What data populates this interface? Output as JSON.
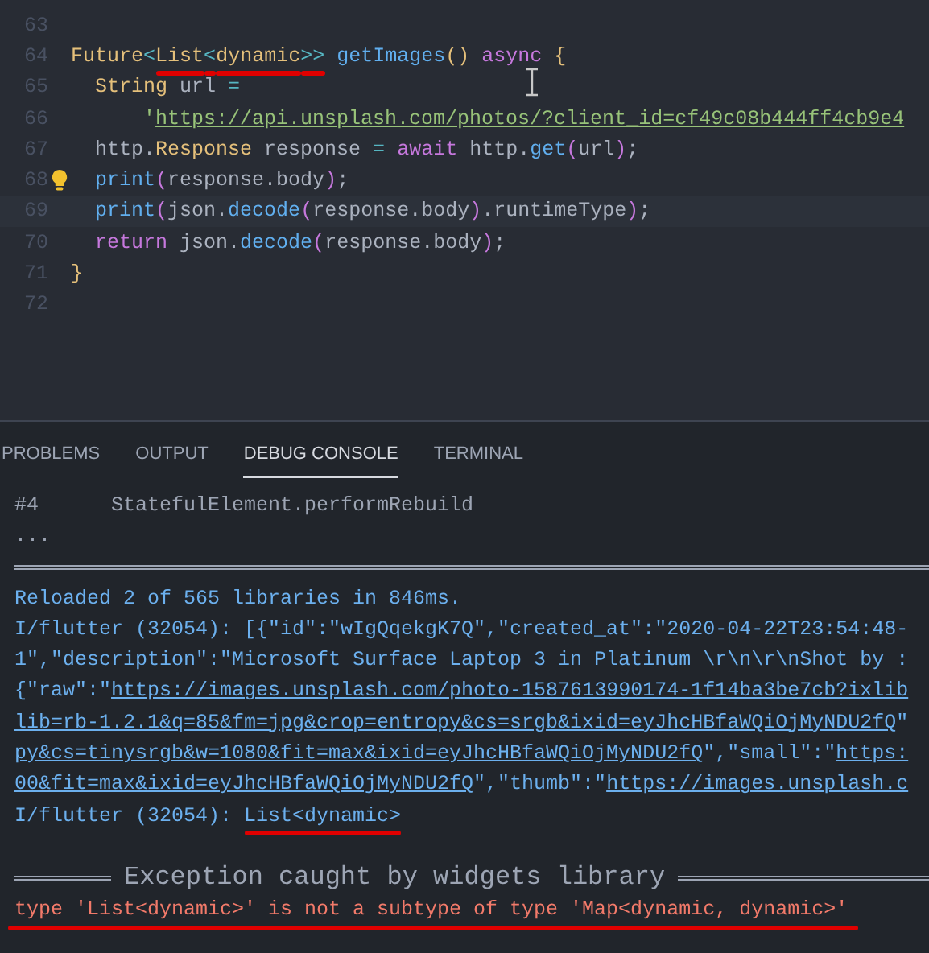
{
  "editor": {
    "lines": [
      {
        "number": "63"
      },
      {
        "number": "64",
        "tokens": [
          {
            "kind": "type",
            "text": "Future"
          },
          {
            "kind": "op",
            "text": "<"
          },
          {
            "kind": "type",
            "text": "List",
            "underlined": true
          },
          {
            "kind": "op",
            "text": "<",
            "underlined": true
          },
          {
            "kind": "type",
            "text": "dynamic",
            "underlined": true
          },
          {
            "kind": "op",
            "text": ">>",
            "underlined": true
          },
          {
            "kind": "fn",
            "text": " getImages"
          },
          {
            "kind": "brace",
            "text": "()"
          },
          {
            "kind": "kw",
            "text": " async"
          },
          {
            "kind": "brace",
            "text": " {"
          }
        ]
      },
      {
        "number": "65",
        "tokens": [
          {
            "kind": "type",
            "text": "  String"
          },
          {
            "kind": "plain",
            "text": " url "
          },
          {
            "kind": "op",
            "text": "="
          }
        ]
      },
      {
        "number": "66",
        "tokens": [
          {
            "kind": "str",
            "text": "      '"
          },
          {
            "kind": "link",
            "text": "https://api.unsplash.com/photos/?client_id=cf49c08b444ff4cb9e4"
          }
        ]
      },
      {
        "number": "67",
        "tokens": [
          {
            "kind": "plain",
            "text": "  http."
          },
          {
            "kind": "type",
            "text": "Response"
          },
          {
            "kind": "plain",
            "text": " response "
          },
          {
            "kind": "op",
            "text": "="
          },
          {
            "kind": "kw",
            "text": " await"
          },
          {
            "kind": "plain",
            "text": " http."
          },
          {
            "kind": "fn",
            "text": "get"
          },
          {
            "kind": "paren",
            "text": "("
          },
          {
            "kind": "plain",
            "text": "url"
          },
          {
            "kind": "paren",
            "text": ")"
          },
          {
            "kind": "plain",
            "text": ";"
          }
        ]
      },
      {
        "number": "68",
        "hint": true,
        "tokens": [
          {
            "kind": "fn",
            "text": "  print"
          },
          {
            "kind": "paren",
            "text": "("
          },
          {
            "kind": "plain",
            "text": "response.body"
          },
          {
            "kind": "paren",
            "text": ")"
          },
          {
            "kind": "plain",
            "text": ";"
          }
        ]
      },
      {
        "number": "69",
        "current": true,
        "tokens": [
          {
            "kind": "fn",
            "text": "  print"
          },
          {
            "kind": "paren",
            "text": "("
          },
          {
            "kind": "plain",
            "text": "json."
          },
          {
            "kind": "fn",
            "text": "decode"
          },
          {
            "kind": "paren",
            "text": "("
          },
          {
            "kind": "plain",
            "text": "response.body"
          },
          {
            "kind": "paren",
            "text": ")"
          },
          {
            "kind": "plain",
            "text": ".runtimeType"
          },
          {
            "kind": "paren",
            "text": ")"
          },
          {
            "kind": "plain",
            "text": ";"
          }
        ]
      },
      {
        "number": "70",
        "tokens": [
          {
            "kind": "kw",
            "text": "  return"
          },
          {
            "kind": "plain",
            "text": " json."
          },
          {
            "kind": "fn",
            "text": "decode"
          },
          {
            "kind": "paren",
            "text": "("
          },
          {
            "kind": "plain",
            "text": "response.body"
          },
          {
            "kind": "paren",
            "text": ")"
          },
          {
            "kind": "plain",
            "text": ";"
          }
        ]
      },
      {
        "number": "71",
        "tokens": [
          {
            "kind": "brace",
            "text": "}"
          }
        ]
      },
      {
        "number": "72"
      }
    ]
  },
  "panel": {
    "tabs": [
      {
        "label": "PROBLEMS",
        "selected": false
      },
      {
        "label": "OUTPUT",
        "selected": false
      },
      {
        "label": "DEBUG CONSOLE",
        "selected": true
      },
      {
        "label": "TERMINAL",
        "selected": false
      }
    ],
    "console": [
      {
        "kind": "text",
        "segments": [
          {
            "kind": "trace",
            "text": "#4      StatefulElement.performRebuild"
          }
        ]
      },
      {
        "kind": "text",
        "segments": [
          {
            "kind": "trace",
            "text": "..."
          }
        ]
      },
      {
        "kind": "rule"
      },
      {
        "kind": "text",
        "segments": [
          {
            "kind": "info",
            "text": "Reloaded 2 of 565 libraries in 846ms."
          }
        ]
      },
      {
        "kind": "text",
        "segments": [
          {
            "kind": "info",
            "text": "I/flutter (32054): [{\"id\":\"wIgQqekgK7Q\",\"created_at\":\"2020-04-22T23:54:48-"
          }
        ]
      },
      {
        "kind": "text",
        "segments": [
          {
            "kind": "info",
            "text": "1\",\"description\":\"Microsoft Surface Laptop 3 in Platinum \\r\\n\\r\\nShot by :"
          }
        ]
      },
      {
        "kind": "text",
        "segments": [
          {
            "kind": "info",
            "text": "{\"raw\":\""
          },
          {
            "kind": "link",
            "text": "https://images.unsplash.com/photo-1587613990174-1f14ba3be7cb?ixlib"
          }
        ]
      },
      {
        "kind": "text",
        "segments": [
          {
            "kind": "link",
            "text": "lib=rb-1.2.1&q=85&fm=jpg&crop=entropy&cs=srgb&ixid=eyJhcHBfaWQiOjMyNDU2fQ"
          },
          {
            "kind": "info",
            "text": "\""
          }
        ]
      },
      {
        "kind": "text",
        "segments": [
          {
            "kind": "link",
            "text": "py&cs=tinysrgb&w=1080&fit=max&ixid=eyJhcHBfaWQiOjMyNDU2fQ"
          },
          {
            "kind": "info",
            "text": "\",\"small\":\""
          },
          {
            "kind": "link",
            "text": "https:"
          }
        ]
      },
      {
        "kind": "text",
        "segments": [
          {
            "kind": "link",
            "text": "00&fit=max&ixid=eyJhcHBfaWQiOjMyNDU2fQ"
          },
          {
            "kind": "info",
            "text": "\",\"thumb\":\""
          },
          {
            "kind": "link",
            "text": "https://images.unsplash.c"
          }
        ]
      },
      {
        "kind": "text",
        "segments": [
          {
            "kind": "info",
            "text": "I/flutter (32054): "
          },
          {
            "kind": "info",
            "text": "List<dynamic>",
            "underlined": true
          }
        ]
      },
      {
        "kind": "blank"
      },
      {
        "kind": "header",
        "segments": [
          {
            "kind": "trace",
            "text": "Exception caught by widgets library"
          }
        ]
      },
      {
        "kind": "text",
        "underlined": true,
        "segments": [
          {
            "kind": "error",
            "text": "type 'List<dynamic>' is not a subtype of type 'Map<dynamic, dynamic>'"
          }
        ]
      }
    ]
  }
}
